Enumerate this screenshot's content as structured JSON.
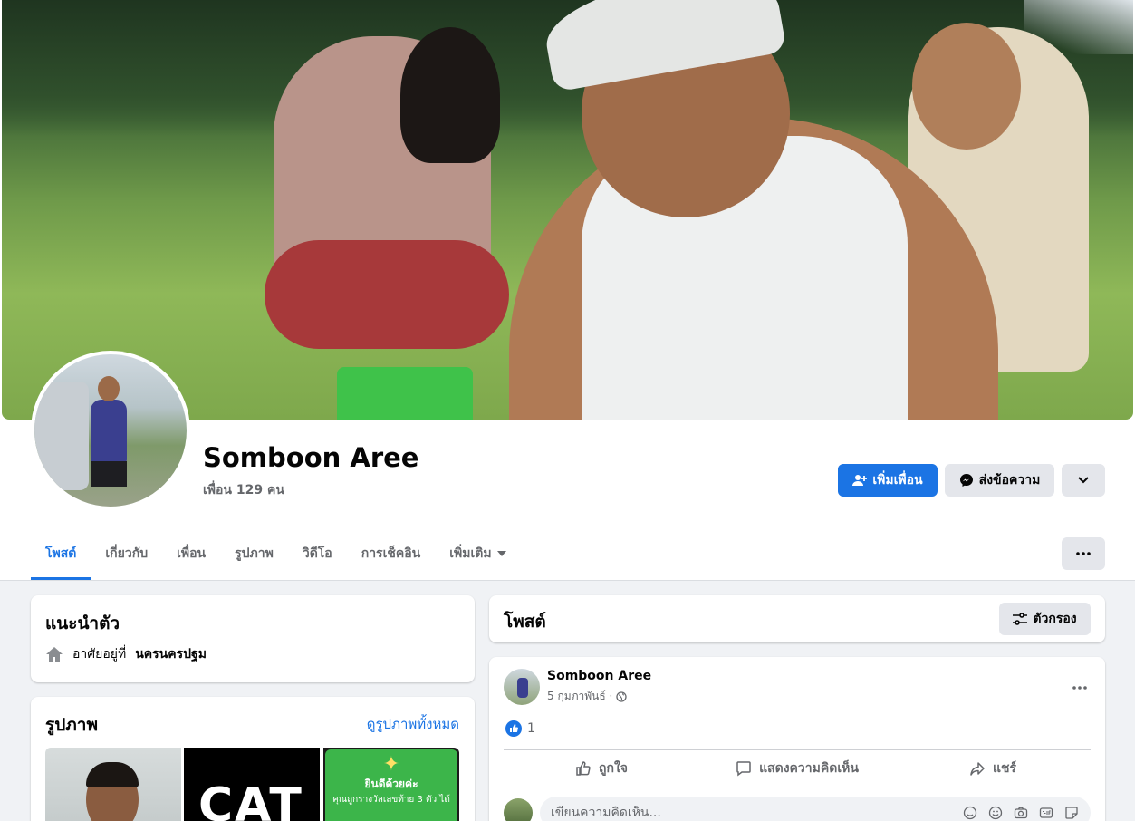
{
  "profile": {
    "name": "Somboon Aree",
    "friends_count": "เพื่อน 129 คน"
  },
  "actions": {
    "add_friend": "เพิ่มเพื่อน",
    "message": "ส่งข้อความ"
  },
  "tabs": [
    {
      "label": "โพสต์",
      "active": true
    },
    {
      "label": "เกี่ยวกับ"
    },
    {
      "label": "เพื่อน"
    },
    {
      "label": "รูปภาพ"
    },
    {
      "label": "วิดีโอ"
    },
    {
      "label": "การเช็คอิน"
    },
    {
      "label": "เพิ่มเติม"
    }
  ],
  "intro": {
    "title": "แนะนำตัว",
    "lives_in_prefix": "อาศัยอยู่ที่",
    "lives_in_place": "นครนครปฐม"
  },
  "photos": {
    "title": "รูปภาพ",
    "see_all": "ดูรูปภาพทั้งหมด",
    "photo2_text": "CAT",
    "photo3_line1": "ยินดีด้วยค่ะ",
    "photo3_line2": "คุณถูกรางวัลเลขท้าย 3 ตัว ได้"
  },
  "posts": {
    "title": "โพสต์",
    "filter": "ตัวกรอง"
  },
  "post": {
    "author": "Somboon Aree",
    "date": "5 กุมภาพันธ์ ·",
    "like_count": "1",
    "like_label": "ถูกใจ",
    "comment_label": "แสดงความคิดเห็น",
    "share_label": "แชร์",
    "comment_placeholder": "เขียนความคิดเห็น..."
  },
  "colors": {
    "accent": "#1b74e4",
    "background": "#f0f2f5",
    "secondary_text": "#65676b"
  }
}
